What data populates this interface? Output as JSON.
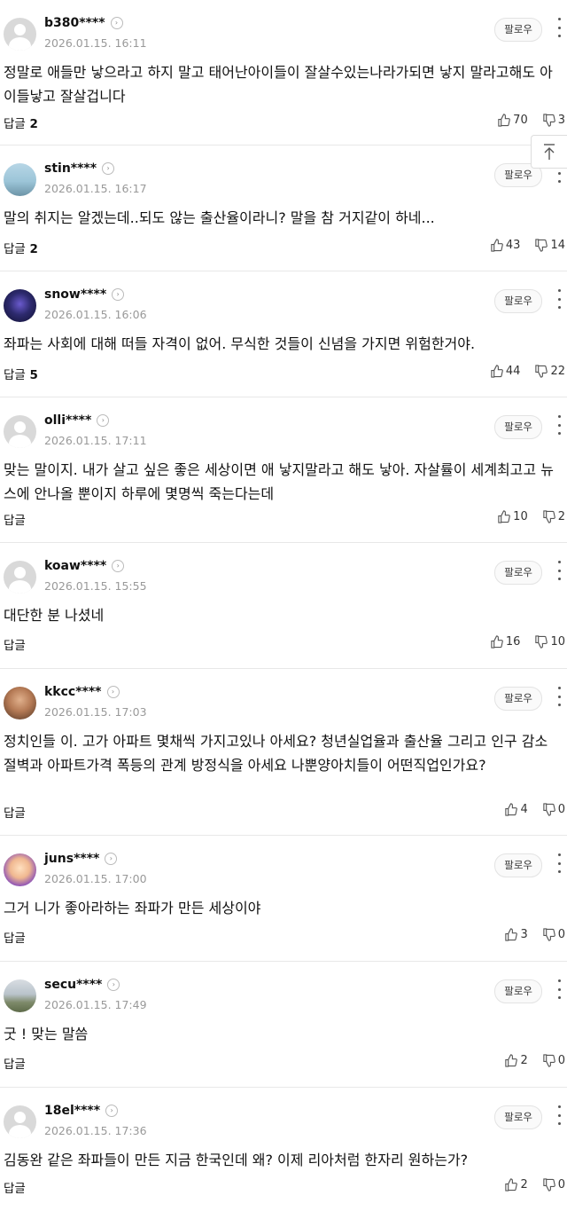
{
  "reply_label": "답글",
  "follow_label": "팔로우",
  "comments": [
    {
      "username": "b380****",
      "date": "2026.01.15. 16:11",
      "text": "정말로 애들만 낳으라고 하지 말고 태어난아이들이 잘살수있는나라가되면 낳지 말라고해도 아이들낳고 잘살겁니다",
      "replies": "2",
      "likes": "70",
      "dislikes": "3",
      "avatar": "default"
    },
    {
      "username": "stin****",
      "date": "2026.01.15. 16:17",
      "text": "말의 취지는 알겠는데..되도 않는 출산율이라니? 말을 참 거지같이 하네...",
      "replies": "2",
      "likes": "43",
      "dislikes": "14",
      "avatar": "sky"
    },
    {
      "username": "snow****",
      "date": "2026.01.15. 16:06",
      "text": "좌파는 사회에 대해 떠들 자격이 없어. 무식한 것들이 신념을 가지면 위험한거야.",
      "replies": "5",
      "likes": "44",
      "dislikes": "22",
      "avatar": "dark"
    },
    {
      "username": "olli****",
      "date": "2026.01.15. 17:11",
      "text": "맞는 말이지. 내가 살고 싶은 좋은 세상이면 애 낳지말라고 해도 낳아. 자살률이 세계최고고 뉴스에 안나올 뿐이지 하루에 몇명씩 죽는다는데",
      "replies": "",
      "likes": "10",
      "dislikes": "2",
      "avatar": "default"
    },
    {
      "username": "koaw****",
      "date": "2026.01.15. 15:55",
      "text": "대단한 분 나셨네",
      "replies": "",
      "likes": "16",
      "dislikes": "10",
      "avatar": "default"
    },
    {
      "username": "kkcc****",
      "date": "2026.01.15. 17:03",
      "text": "정치인들 이. 고가 아파트 몇채씩 가지고있나 아세요? 청년실업율과 출산율 그리고 인구 감소절벽과 아파트가격 폭등의 관계 방정식을 아세요 나뿐양아치들이 어떤직업인가요?",
      "replies": "",
      "likes": "4",
      "dislikes": "0",
      "avatar": "man"
    },
    {
      "username": "juns****",
      "date": "2026.01.15. 17:00",
      "text": "그거 니가 좋아라하는 좌파가 만든 세상이야",
      "replies": "",
      "likes": "3",
      "dislikes": "0",
      "avatar": "cartoon"
    },
    {
      "username": "secu****",
      "date": "2026.01.15. 17:49",
      "text": "굿 ! 맞는 말씀",
      "replies": "",
      "likes": "2",
      "dislikes": "0",
      "avatar": "land"
    },
    {
      "username": "18el****",
      "date": "2026.01.15. 17:36",
      "text": "김동완 같은 좌파들이 만든 지금 한국인데 왜? 이제 리아처럼 한자리 원하는가?",
      "replies": "",
      "likes": "2",
      "dislikes": "0",
      "avatar": "default"
    }
  ]
}
